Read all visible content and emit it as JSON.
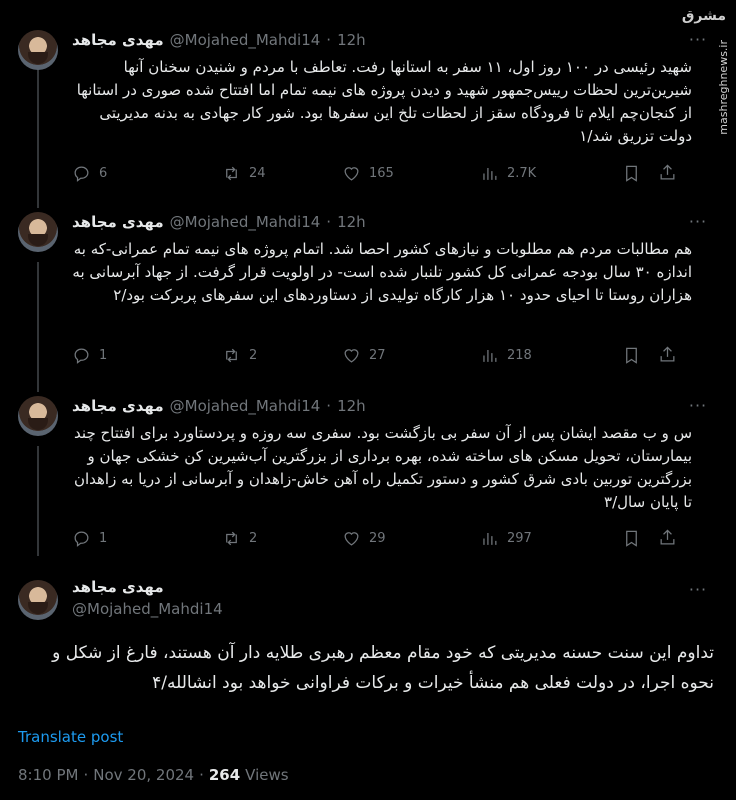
{
  "author": {
    "name": "مهدی مجاهد",
    "handle": "@Mojahed_Mahdi14"
  },
  "watermark": {
    "logo": "مشرق",
    "site": "mashreghnews.ir"
  },
  "tweets": [
    {
      "time": "12h",
      "text": "شهید رئیسی در ۱۰۰ روز اول، ۱۱ سفر به استانها رفت. تعاطف با مردم و شنیدن سخنان آنها شیرین‌ترین لحظات رییس‌جمهور شهید و دیدن پروژه های نیمه تمام اما افتتاح شده صوری در استانها از کنجان‌چم ایلام تا فرودگاه سقز از لحظات تلخ این سفرها بود. شور کار جهادی به بدنه مدیریتی دولت تزریق شد/۱",
      "replies": "6",
      "reposts": "24",
      "likes": "165",
      "views": "2.7K"
    },
    {
      "time": "12h",
      "text": "هم مطالبات مردم هم مطلوبات و نیازهای کشور احصا شد. اتمام پروژه های نیمه تمام عمرانی-که به اندازه ۳۰ سال بودجه عمرانی کل کشور تلنبار شده است- در اولویت قرار گرفت. از جهاد آبرسانی به هزاران روستا تا احیای حدود ۱۰ هزار کارگاه تولیدی از دستاوردهای این سفرهای پربرکت بود/۲",
      "replies": "1",
      "reposts": "2",
      "likes": "27",
      "views": "218"
    },
    {
      "time": "12h",
      "text": "س و ب مقصد ایشان پس از آن سفر بی بازگشت بود. سفری سه روزه و پردستاورد برای افتتاح چند بیمارستان، تحویل مسکن های ساخته شده، بهره برداری از بزرگترین آب‌شیرین کن خشکی جهان و بزرگترین توربین بادی شرق کشور و دستور تکمیل راه آهن خاش-زاهدان و آبرسانی از دریا به زاهدان تا پایان سال/۳",
      "replies": "1",
      "reposts": "2",
      "likes": "29",
      "views": "297"
    }
  ],
  "main": {
    "text": "تداوم این سنت حسنه مدیریتی که خود مقام معظم رهبری طلایه دار آن هستند، فارغ از شکل و نحوه اجرا، در دولت فعلی هم منشأ خیرات و برکات فراوانی خواهد بود انشالله/۴",
    "translate": "Translate post",
    "time": "8:10 PM",
    "date": "Nov 20, 2024",
    "views_count": "264",
    "views_label": "Views"
  },
  "ui": {
    "separator": "·",
    "more": "···"
  }
}
